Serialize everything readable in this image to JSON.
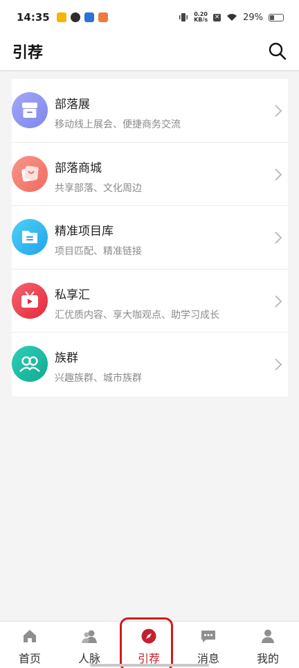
{
  "status_bar": {
    "time": "14:35",
    "net_speed_value": "0.20",
    "net_speed_unit": "KB/s",
    "battery": "29%",
    "icons": [
      "weibo-icon",
      "app-icon",
      "app-icon",
      "app-icon",
      "vibrate-icon",
      "close-icon",
      "wifi-icon",
      "battery-icon"
    ]
  },
  "header": {
    "title": "引荐",
    "search_icon": "search-icon"
  },
  "list": [
    {
      "title": "部落展",
      "subtitle": "移动线上展会、便捷商务交流",
      "icon": "archive-icon",
      "color": "#8b93f2"
    },
    {
      "title": "部落商城",
      "subtitle": "共享部落、文化周边",
      "icon": "shopping-bag-icon",
      "color": "#f47a6c"
    },
    {
      "title": "精准项目库",
      "subtitle": "项目匹配、精准链接",
      "icon": "folder-icon",
      "color": "#2eb6ee"
    },
    {
      "title": "私享汇",
      "subtitle": "汇优质内容、享大咖观点、助学习成长",
      "icon": "tv-icon",
      "color": "#ee3f4e"
    },
    {
      "title": "族群",
      "subtitle": "兴趣族群、城市族群",
      "icon": "group-icon",
      "color": "#1ebda6"
    }
  ],
  "tabbar": {
    "tabs": [
      {
        "label": "首页",
        "icon": "home-icon"
      },
      {
        "label": "人脉",
        "icon": "contacts-icon"
      },
      {
        "label": "引荐",
        "icon": "compass-icon",
        "active": true
      },
      {
        "label": "消息",
        "icon": "message-icon"
      },
      {
        "label": "我的",
        "icon": "profile-icon"
      }
    ],
    "active_color": "#c4202e"
  }
}
